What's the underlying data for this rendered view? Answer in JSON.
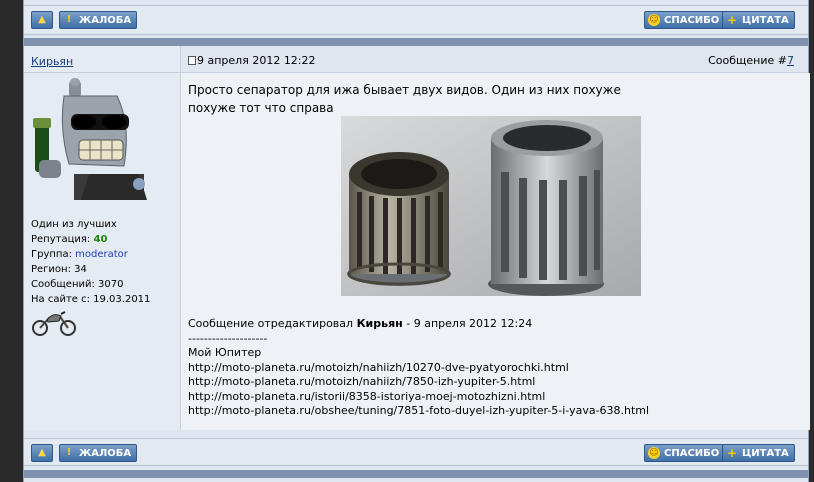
{
  "top_bar": {
    "up_label": "",
    "complaint_label": "ЖАЛОБА",
    "thanks_label": "СПАСИБО",
    "quote_label": "ЦИТАТА"
  },
  "post": {
    "author": "Кирьян",
    "date": "9 апреля 2012 12:22",
    "message_prefix": "Сообщение #",
    "message_number": "7",
    "author_info": {
      "rank": "Один из лучших",
      "reputation_label": "Репутация:",
      "reputation_value": "40",
      "group_label": "Группа:",
      "group_value": "moderator",
      "region": "Регион: 34",
      "messages": "Сообщений: 3070",
      "since": "На сайте с: 19.03.2011"
    },
    "text_line1": "Просто сепаратор для ижа бывает двух видов. Один из них похуже",
    "text_line2": "похуже тот что справа",
    "edit": {
      "prefix": "Сообщение отредактировал",
      "editor": "Кирьян",
      "suffix": "- 9 апреля 2012 12:24",
      "divider": "--------------------",
      "signature_title": "Мой Юпитер",
      "links": [
        "http://moto-planeta.ru/motoizh/nahiizh/10270-dve-pyatyorochki.html",
        "http://moto-planeta.ru/motoizh/nahiizh/7850-izh-yupiter-5.html",
        "http://moto-planeta.ru/istorii/8358-istoriya-moej-motozhizni.html",
        "http://moto-planeta.ru/obshee/tuning/7851-foto-duyel-izh-yupiter-5-i-yava-638.html"
      ]
    }
  },
  "bottom_bar": {
    "complaint_label": "ЖАЛОБА",
    "thanks_label": "СПАСИБО",
    "quote_label": "ЦИТАТА"
  }
}
